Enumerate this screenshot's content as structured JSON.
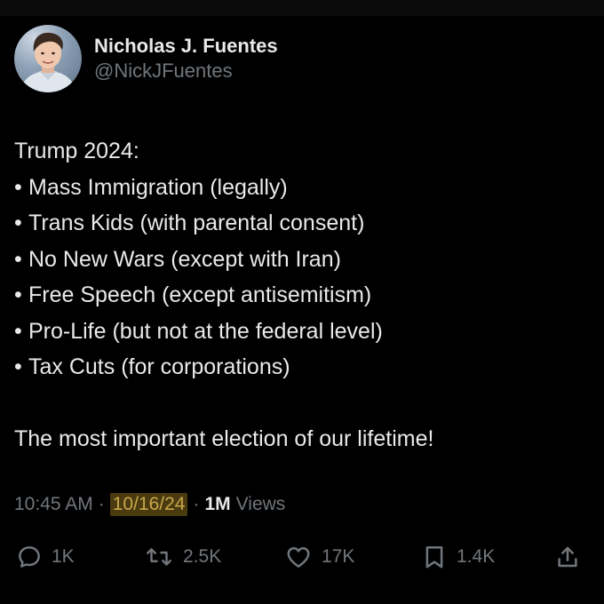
{
  "author": {
    "display_name": "Nicholas J. Fuentes",
    "handle": "@NickJFuentes"
  },
  "post": {
    "heading": "Trump 2024:",
    "bullet_char": "•",
    "items": [
      "Mass Immigration (legally)",
      "Trans Kids (with parental consent)",
      "No New Wars (except with Iran)",
      "Free Speech (except antisemitism)",
      "Pro-Life (but not at the federal level)",
      "Tax Cuts (for corporations)"
    ],
    "closing": "The most important election of our lifetime!"
  },
  "meta": {
    "time": "10:45 AM",
    "separator": "·",
    "date": "10/16/24",
    "views_count": "1M",
    "views_label": "Views"
  },
  "actions": {
    "reply_count": "1K",
    "repost_count": "2.5K",
    "like_count": "17K",
    "bookmark_count": "1.4K"
  },
  "colors": {
    "background": "#000000",
    "text_primary": "#e7e9ea",
    "text_secondary": "#71767b",
    "date_highlight_bg": "#4a3a10",
    "date_highlight_text": "#c9a74a"
  },
  "icons": [
    "reply-icon",
    "repost-icon",
    "like-icon",
    "bookmark-icon",
    "share-icon"
  ]
}
